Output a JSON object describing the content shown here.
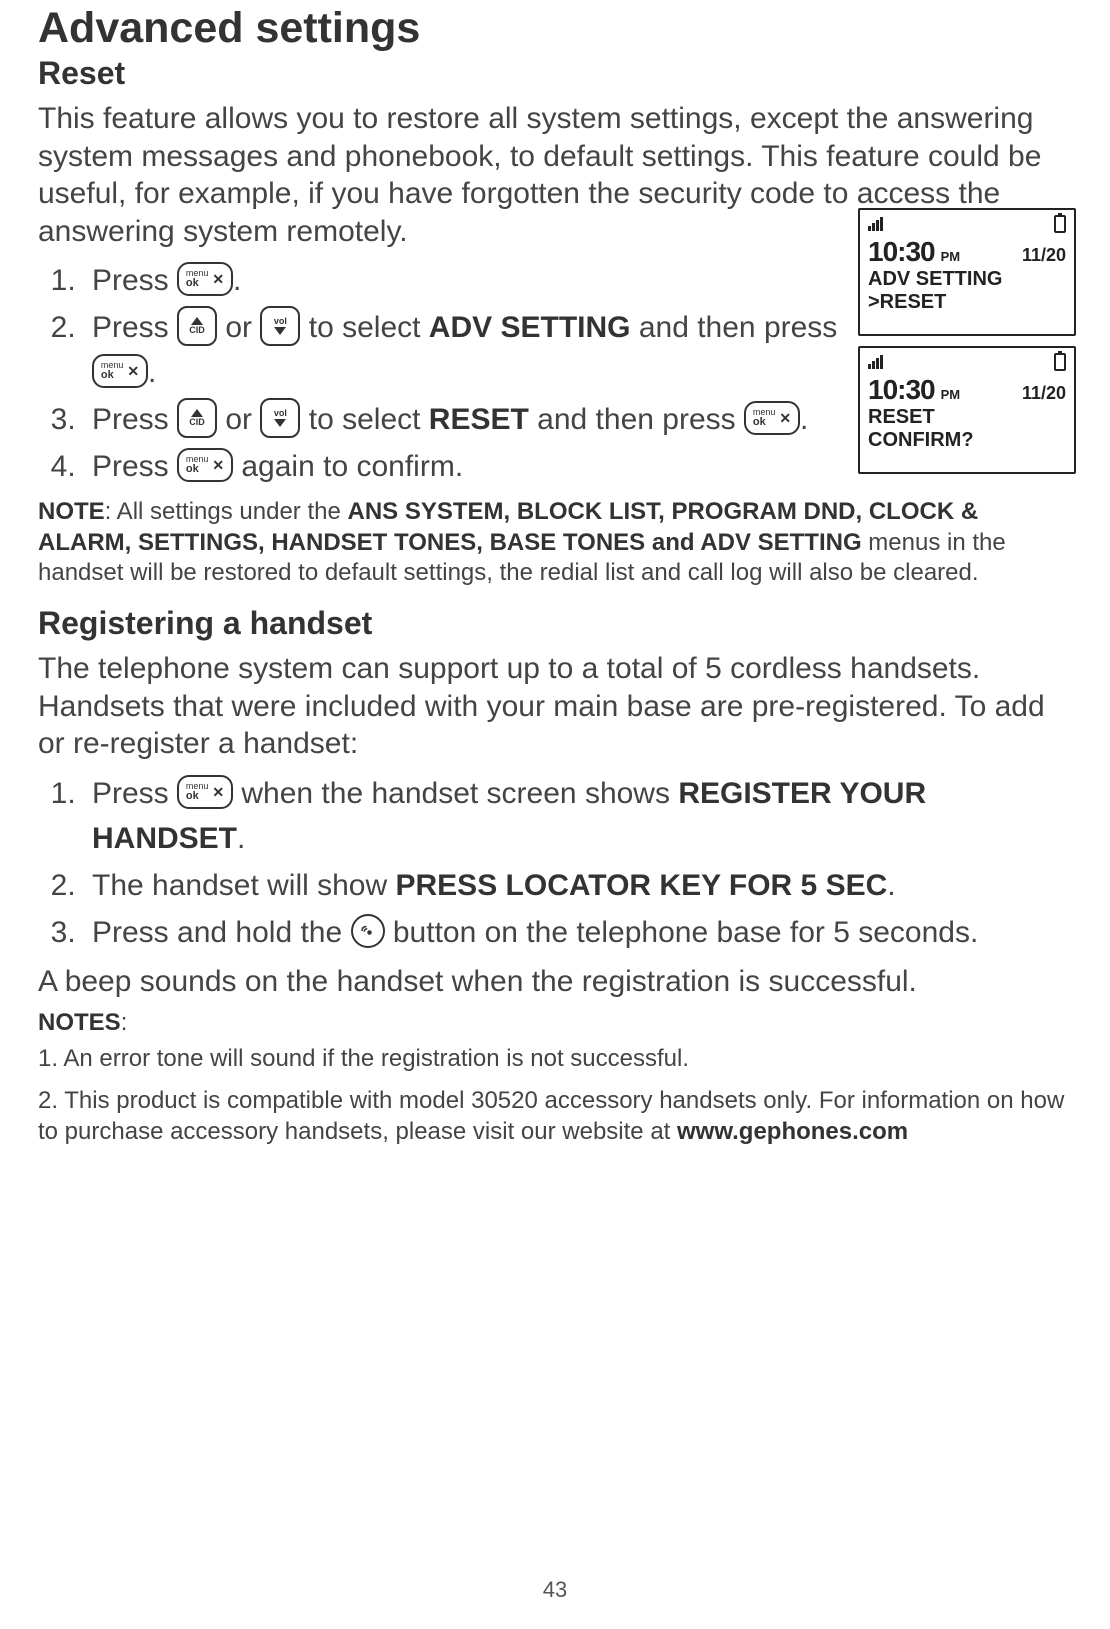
{
  "title": "Advanced settings",
  "section_reset_title": "Reset",
  "reset_intro": "This feature allows you to restore all system settings, except the answering system messages and phonebook, to default settings. This feature could be useful, for example, if you have forgotten the security code to access the answering system remotely.",
  "reset_steps": {
    "s1a": "Press ",
    "s1b": ".",
    "s2a": "Press ",
    "s2b": " or ",
    "s2c": " to select ",
    "s2d": "ADV SETTING",
    "s2e": " and then press ",
    "s2f": ".",
    "s3a": "Press ",
    "s3b": " or ",
    "s3c": " to select ",
    "s3d": "RESET",
    "s3e": " and then press ",
    "s3f": ".",
    "s4a": "Press ",
    "s4b": " again to confirm."
  },
  "reset_note_prefix": "NOTE",
  "reset_note_body_a": ": All settings under the ",
  "reset_note_bold": "ANS SYSTEM, BLOCK LIST, PROGRAM DND, CLOCK & ALARM, SETTINGS, HANDSET TONES, BASE TONES and ADV SETTING",
  "reset_note_body_b": " menus in the handset will be restored to default settings, the redial list and call log will also be cleared.",
  "section_register_title": "Registering a handset",
  "register_intro": "The telephone system can support up to a total of 5 cordless handsets. Handsets that were included with your main base are pre-registered. To add or re-register a handset:",
  "register_steps": {
    "s1a": "Press ",
    "s1b": " when the handset screen shows ",
    "s1c": "REGISTER YOUR HANDSET",
    "s1d": ".",
    "s2a": "The handset will show ",
    "s2b": "PRESS LOCATOR KEY FOR 5 SEC",
    "s2c": ".",
    "s3a": "Press and hold the ",
    "s3b": " button on the telephone base for 5 seconds."
  },
  "register_after": "A beep sounds on the handset when the registration is successful.",
  "notes_label": "NOTES",
  "notes_colon": ":",
  "note_items": {
    "n1": "1. An error tone will sound if the registration is not successful.",
    "n2a": "2. This product is compatible with model 30520 accessory handsets only. For information on how to purchase accessory handsets, please visit our website at ",
    "n2b": "www.gephones.com"
  },
  "screens": {
    "time": "10:30",
    "ampm": "PM",
    "date": "11/20",
    "scr1_l1": "ADV SETTING",
    "scr1_l2": ">RESET",
    "scr2_l1": "RESET",
    "scr2_l2": "CONFIRM?"
  },
  "keys": {
    "menu_l1": "menu",
    "menu_l2": "ok",
    "cid": "CID",
    "vol": "vol"
  },
  "page_number": "43"
}
